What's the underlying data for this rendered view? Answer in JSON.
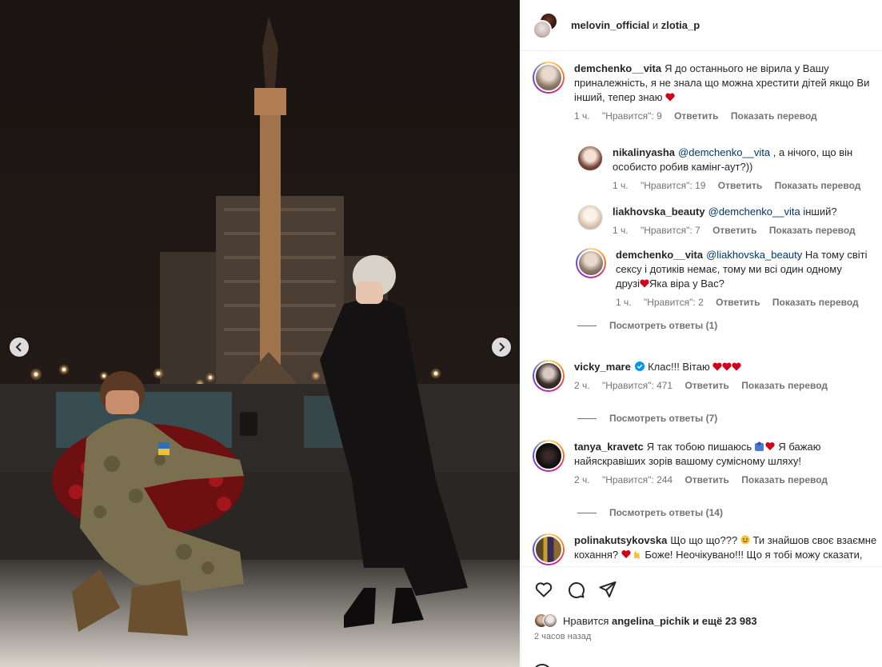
{
  "post": {
    "author": "melovin_official",
    "conjunction": "и",
    "coauthor": "zlotia_p"
  },
  "comments": [
    {
      "user": "demchenko__vita",
      "lines": [
        "Я до останнього не вірила у Вашу",
        "приналежність, я не знала що можна хрестити дітей якщо Ви",
        "інший, тепер знаю"
      ],
      "time": "1 ч.",
      "likes": "\"Нравится\": 9",
      "reply": "Ответить",
      "translate": "Показать перевод"
    },
    {
      "user": "nikalinyasha",
      "mention": "@demchenko__vita",
      "lines": [
        ", а нічого, що він",
        "особисто робив камінг-аут?))"
      ],
      "time": "1 ч.",
      "likes": "\"Нравится\": 19",
      "reply": "Ответить",
      "translate": "Показать перевод"
    },
    {
      "user": "liakhovska_beauty",
      "mention": "@demchenko__vita",
      "lines": [
        "інший?"
      ],
      "time": "1 ч.",
      "likes": "\"Нравится\": 7",
      "reply": "Ответить",
      "translate": "Показать перевод"
    },
    {
      "user": "demchenko__vita",
      "mention": "@liakhovska_beauty",
      "lines": [
        "На тому світі",
        "сексу і дотиків немає, тому ми всі один одному",
        "друзі",
        "Яка віра у Вас?"
      ],
      "time": "1 ч.",
      "likes": "\"Нравится\": 2",
      "reply": "Ответить",
      "translate": "Показать перевод"
    },
    {
      "user": "vicky_mare",
      "lines": [
        "Клас!!! Вітаю"
      ],
      "time": "2 ч.",
      "likes": "\"Нравится\": 471",
      "reply": "Ответить",
      "translate": "Показать перевод"
    },
    {
      "user": "tanya_kravetc",
      "lines": [
        "Я так тобою пишаюсь",
        "Я бажаю",
        "найяскравіших зорів вашому сумісному шляху!"
      ],
      "time": "2 ч.",
      "likes": "\"Нравится\": 244",
      "reply": "Ответить",
      "translate": "Показать перевод"
    },
    {
      "user": "polinakutsykovska",
      "lines": [
        "Що що що???",
        "Ти знайшов своє взаємне",
        "кохання?",
        "Боже! Неочікувано!!! Що я тобі можу сказати,"
      ]
    }
  ],
  "view_replies": [
    "Посмотреть ответы (1)",
    "Посмотреть ответы (7)",
    "Посмотреть ответы (14)"
  ],
  "icons": {
    "like": "heart-outline-icon",
    "comment": "speech-bubble-icon",
    "share": "paper-plane-icon",
    "verified": "verified-badge-icon"
  },
  "likes_summary": {
    "prefix": "Нравится",
    "user": "angelina_pichik",
    "suffix": "и ещё 23 983"
  },
  "time_ago": "2 часов назад",
  "colors": {
    "heart_red": "#d0021b",
    "verified_blue": "#0095f6",
    "mention_blue": "#00376b",
    "meta_gray": "#737373"
  }
}
